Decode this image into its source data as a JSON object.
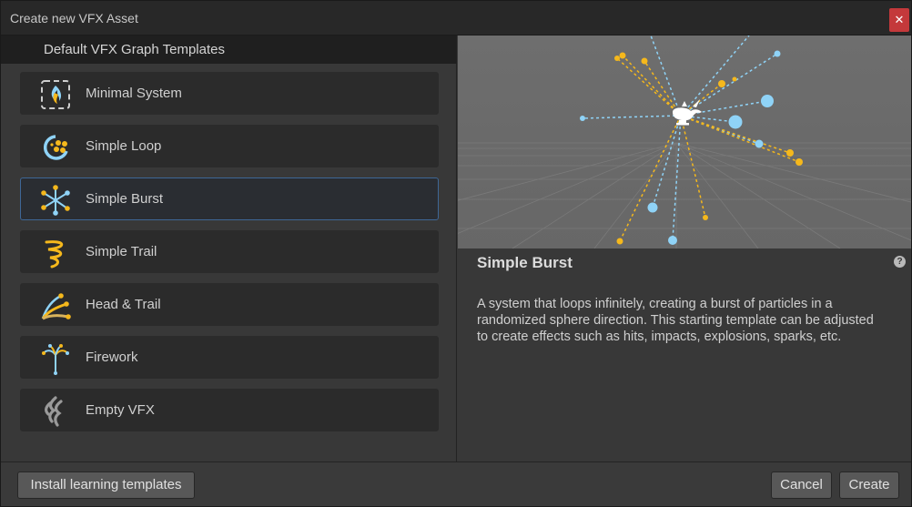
{
  "window": {
    "title": "Create new VFX Asset",
    "close_glyph": "✕"
  },
  "sidebar": {
    "header": "Default VFX Graph Templates",
    "items": [
      {
        "label": "Minimal System",
        "icon": "minimal-system-icon"
      },
      {
        "label": "Simple Loop",
        "icon": "simple-loop-icon"
      },
      {
        "label": "Simple Burst",
        "icon": "simple-burst-icon",
        "selected": true
      },
      {
        "label": "Simple Trail",
        "icon": "simple-trail-icon"
      },
      {
        "label": "Head & Trail",
        "icon": "head-trail-icon"
      },
      {
        "label": "Firework",
        "icon": "firework-icon"
      },
      {
        "label": "Empty VFX",
        "icon": "empty-vfx-icon"
      }
    ]
  },
  "detail": {
    "title": "Simple Burst",
    "help_glyph": "?",
    "description": "A system that loops infinitely, creating a burst of particles in a randomized sphere direction. This starting template can be adjusted to create effects such as hits, impacts, explosions, sparks, etc."
  },
  "footer": {
    "install_label": "Install learning templates",
    "cancel_label": "Cancel",
    "create_label": "Create"
  },
  "colors": {
    "accent_blue": "#8fd3f7",
    "accent_yellow": "#f5b81c",
    "selection_border": "#3e6796"
  }
}
